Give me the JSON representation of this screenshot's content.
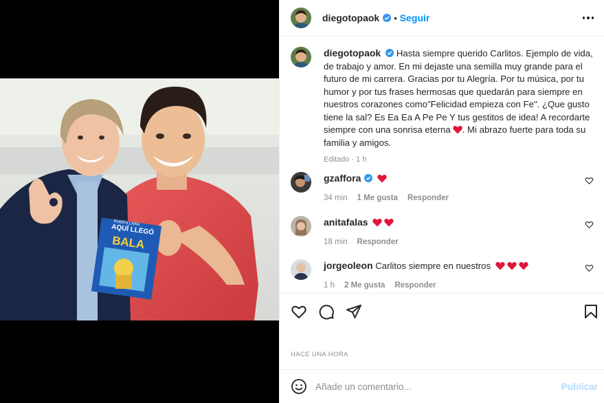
{
  "post": {
    "author": "diegotopaok",
    "follow_label": "Seguir",
    "separator": "•",
    "menu_icon": "more-horizontal-icon",
    "verified_icon": "verified-badge-icon"
  },
  "caption": {
    "username": "diegotopaok",
    "text": "Hasta siempre querido Carlitos. Ejemplo de vida, de trabajo y amor. En mi dejaste una semilla muy grande para el futuro de mi carrera. Gracias por tu Alegría. Por tu música, por tu humor y por tus frases hermosas que quedarán para siempre en nuestros corazones como\"Felicidad empieza con Fe\". ¿Que gusto tiene la sal? Es Ea Ea A Pe Pe Y tus gestitos de idea! A recordarte siempre con una sonrisa eterna",
    "text_after_heart": ". Mi abrazo fuerte para toda su familia y amigos.",
    "meta": "Editado · 1 h"
  },
  "comments": [
    {
      "username": "gzaffora",
      "verified": true,
      "text": "",
      "hearts": 1,
      "time": "34 min",
      "likes": "1 Me gusta",
      "reply": "Responder"
    },
    {
      "username": "anitafalas",
      "verified": false,
      "text": "",
      "hearts": 2,
      "time": "18 min",
      "likes": "",
      "reply": "Responder"
    },
    {
      "username": "jorgeoleon",
      "verified": false,
      "text": "Carlitos siempre en nuestros",
      "hearts": 3,
      "time": "1 h",
      "likes": "2 Me gusta",
      "reply": "Responder"
    }
  ],
  "actions": {
    "like_icon": "heart-icon",
    "comment_icon": "comment-icon",
    "share_icon": "send-icon",
    "save_icon": "bookmark-icon"
  },
  "timestamp": "HACE UNA HORA",
  "add_comment": {
    "placeholder": "Añade un comentario...",
    "publish_label": "Publicar",
    "emoji_icon": "smiley-icon"
  },
  "photo_book": {
    "top_text": "AQUÍ LLEGÓ",
    "title": "BALA",
    "author": "RUBEN LARA"
  },
  "colors": {
    "link": "#0095f6",
    "publish_disabled": "#b3dbff",
    "heart_red": "#e0173a",
    "text_muted": "#8e8e8e",
    "text": "#262626"
  }
}
